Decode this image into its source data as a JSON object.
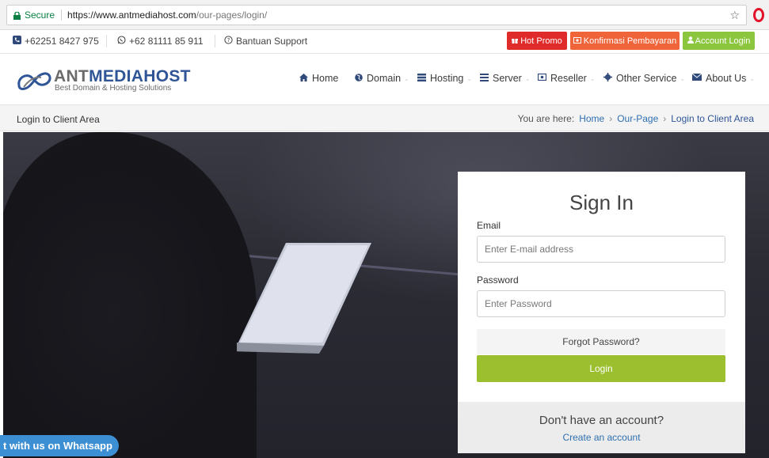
{
  "browser": {
    "secure_label": "Secure",
    "url_host": "https://www.antmediahost.com",
    "url_path": "/our-pages/login/"
  },
  "topbar": {
    "phone": "+62251 8427 975",
    "whatsapp": "+62 81111 85 911",
    "support": "Bantuan Support",
    "hot_promo": "Hot Promo",
    "konfirmasi": "Konfirmasi Pembayaran",
    "account_login": "Account Login"
  },
  "logo": {
    "name_part1": "ANT",
    "name_part2": "MEDIAHOST",
    "tagline": "Best Domain & Hosting Solutions"
  },
  "nav": {
    "items": [
      {
        "label": "Home"
      },
      {
        "label": "Domain"
      },
      {
        "label": "Hosting"
      },
      {
        "label": "Server"
      },
      {
        "label": "Reseller"
      },
      {
        "label": "Other Service"
      },
      {
        "label": "About Us"
      }
    ]
  },
  "breadcrumb": {
    "page_title": "Login to Client Area",
    "prefix": "You are here:",
    "home": "Home",
    "our_page": "Our-Page",
    "current": "Login to Client Area"
  },
  "signin": {
    "title": "Sign In",
    "email_label": "Email",
    "email_placeholder": "Enter E-mail address",
    "password_label": "Password",
    "password_placeholder": "Enter Password",
    "forgot": "Forgot Password?",
    "login": "Login",
    "no_account": "Don't have an account?",
    "create": "Create an account"
  },
  "chat": {
    "label": "t with us on Whatsapp"
  },
  "colors": {
    "accent_green": "#9bbf2e",
    "hot_red": "#e02b2b",
    "konf_orange": "#f0643a",
    "account_green": "#8cc63f",
    "brand_blue": "#2f5597",
    "whatsapp_blue": "#3d8fd4"
  }
}
